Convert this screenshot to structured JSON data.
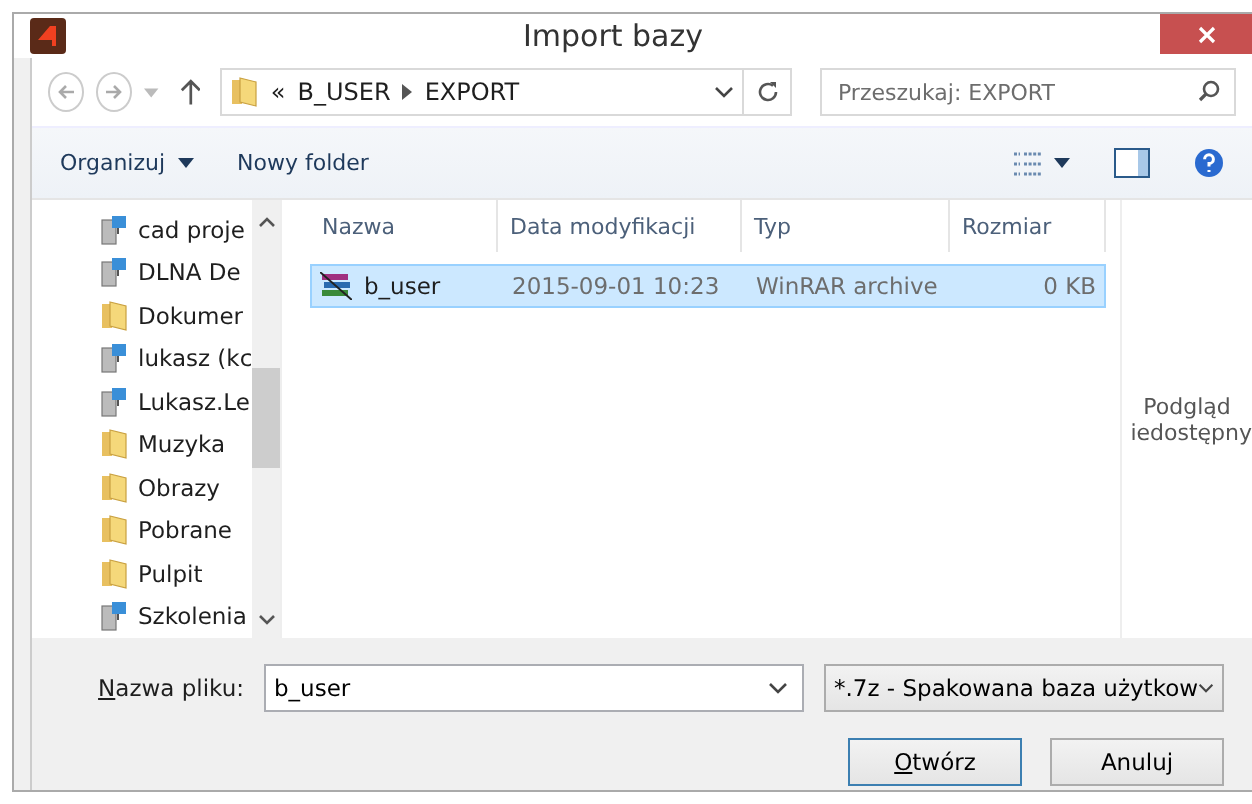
{
  "window": {
    "title": "Import bazy"
  },
  "address": {
    "overflow": "«",
    "path": [
      "B_USER",
      "EXPORT"
    ]
  },
  "search": {
    "placeholder": "Przeszukaj: EXPORT"
  },
  "toolbar": {
    "organize": "Organizuj",
    "new_folder": "Nowy folder"
  },
  "sidebar": {
    "items": [
      {
        "label": "cad proje",
        "kind": "network"
      },
      {
        "label": "DLNA De",
        "kind": "network"
      },
      {
        "label": "Dokumer",
        "kind": "documents"
      },
      {
        "label": "lukasz (kc",
        "kind": "network"
      },
      {
        "label": "Lukasz.Le",
        "kind": "network"
      },
      {
        "label": "Muzyka",
        "kind": "music"
      },
      {
        "label": "Obrazy",
        "kind": "pictures"
      },
      {
        "label": "Pobrane",
        "kind": "downloads"
      },
      {
        "label": "Pulpit",
        "kind": "desktop"
      },
      {
        "label": "Szkolenia",
        "kind": "network"
      }
    ]
  },
  "table": {
    "columns": [
      "Nazwa",
      "Data modyfikacji",
      "Typ",
      "Rozmiar"
    ],
    "rows": [
      {
        "name": "b_user",
        "date": "2015-09-01 10:23",
        "type": "WinRAR archive",
        "size": "0 KB",
        "selected": true
      }
    ]
  },
  "preview": [
    "Podgląd",
    "iedostępny"
  ],
  "filename": {
    "label": "Nazwa pliku:",
    "value": "b_user"
  },
  "filter": {
    "value": "*.7z - Spakowana baza użytkow"
  },
  "buttons": [
    "Otwórz",
    "Anuluj"
  ]
}
